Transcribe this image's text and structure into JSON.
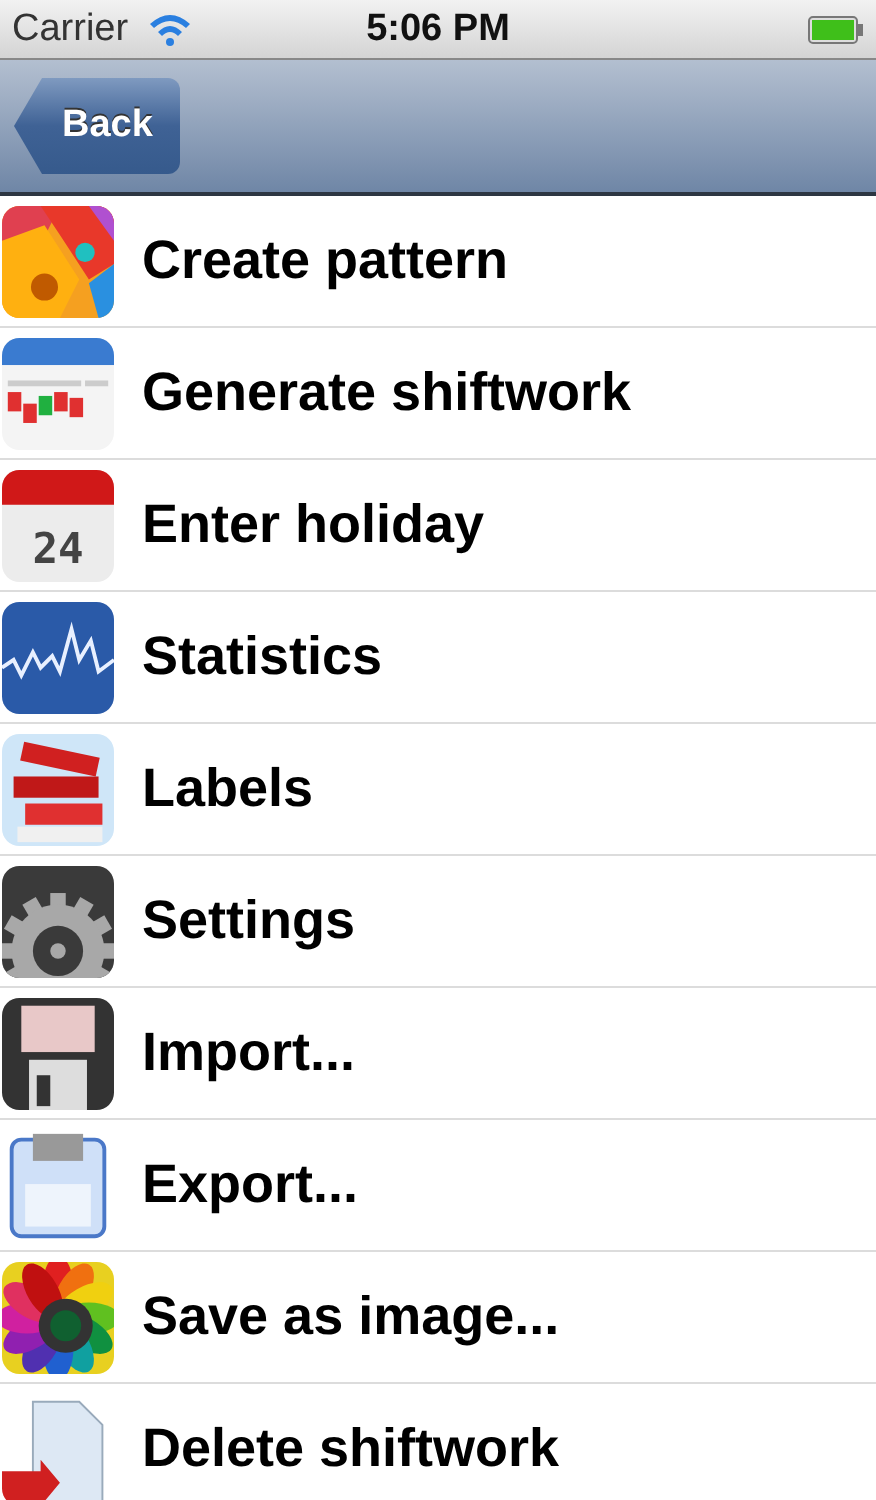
{
  "status_bar": {
    "carrier": "Carrier",
    "time": "5:06 PM"
  },
  "nav_bar": {
    "back_button": "Back"
  },
  "menu": [
    {
      "label": "Create pattern",
      "kind": "shapes"
    },
    {
      "label": "Generate shiftwork",
      "kind": "schedule"
    },
    {
      "label": "Enter holiday",
      "kind": "calendar",
      "icon_text": "24"
    },
    {
      "label": "Statistics",
      "kind": "chart"
    },
    {
      "label": "Labels",
      "kind": "books"
    },
    {
      "label": "Settings",
      "kind": "gear"
    },
    {
      "label": "Import...",
      "kind": "floppy_dark"
    },
    {
      "label": "Export...",
      "kind": "floppy_blue"
    },
    {
      "label": "Save as image...",
      "kind": "lens"
    },
    {
      "label": "Delete shiftwork",
      "kind": "document"
    }
  ]
}
